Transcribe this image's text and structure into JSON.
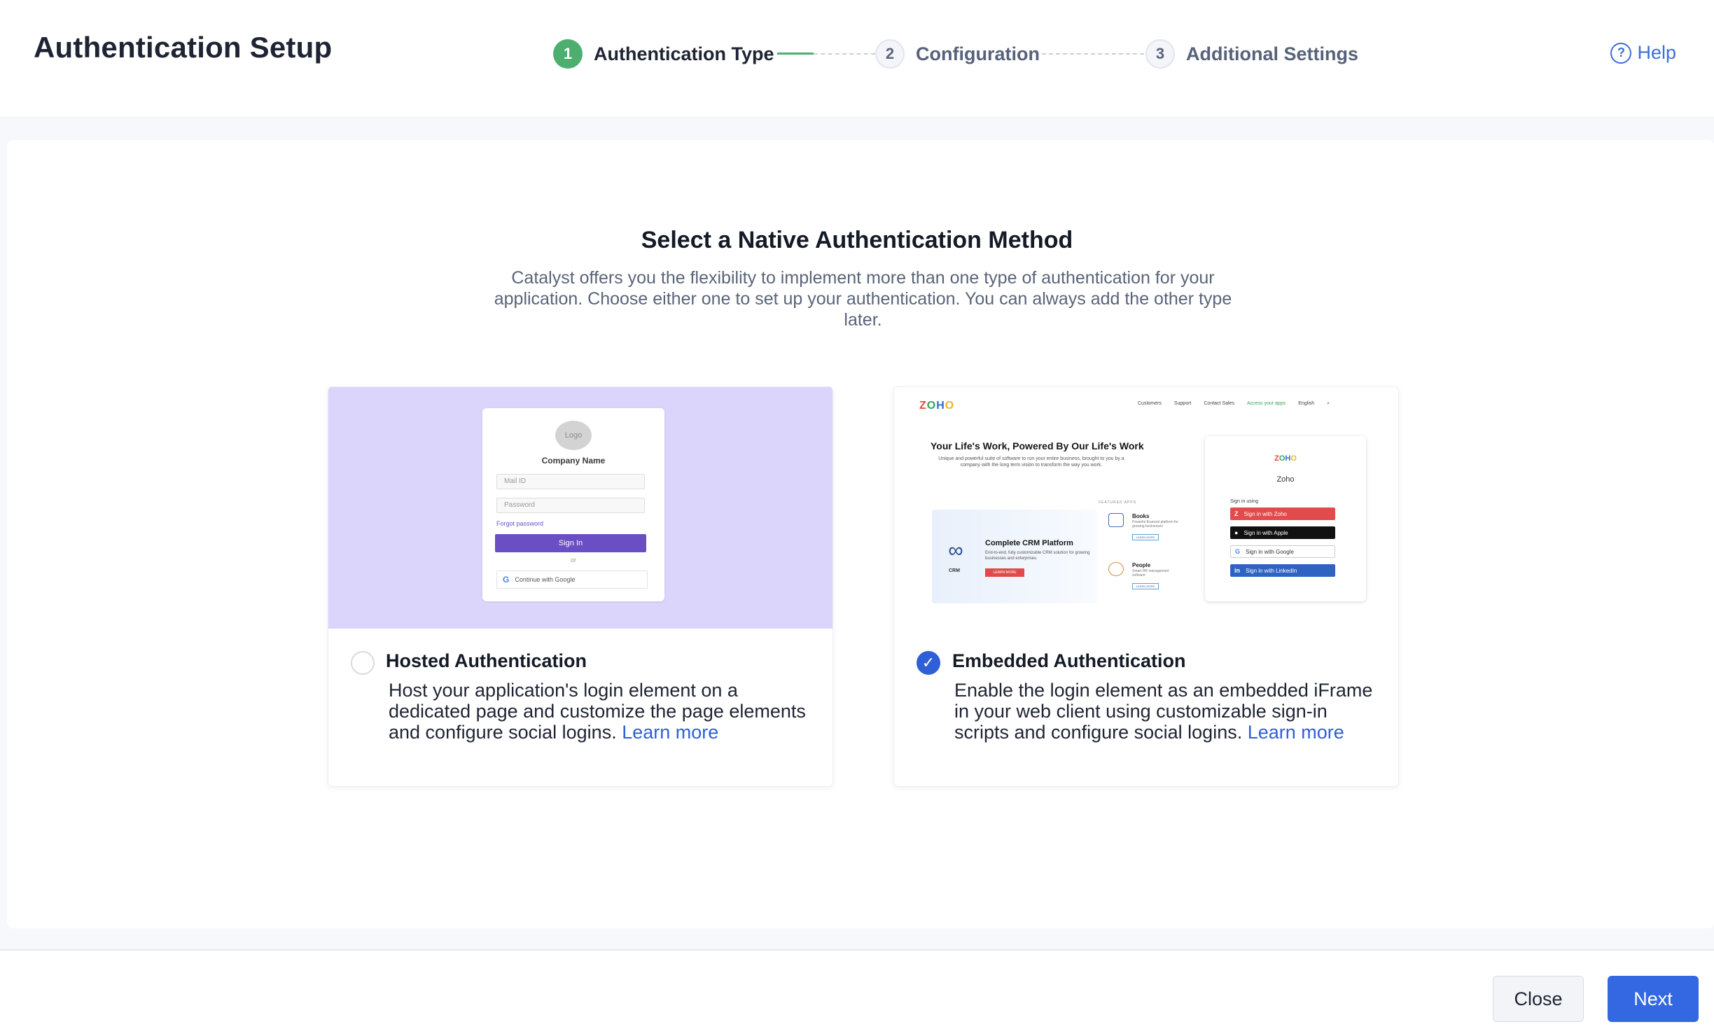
{
  "header": {
    "title": "Authentication Setup",
    "help_label": "Help",
    "help_icon": "question-circle-icon"
  },
  "stepper": {
    "steps": [
      {
        "number": "1",
        "label": "Authentication Type",
        "state": "active"
      },
      {
        "number": "2",
        "label": "Configuration",
        "state": "pending"
      },
      {
        "number": "3",
        "label": "Additional Settings",
        "state": "pending"
      }
    ],
    "active_color": "#4caf70"
  },
  "main": {
    "title": "Select a Native Authentication Method",
    "description": "Catalyst offers you the flexibility to implement more than one type of authentication for your application. Choose either one to set up your authentication. You can always add the other type later."
  },
  "options": {
    "hosted": {
      "title": "Hosted Authentication",
      "description": "Host your application's login element on a dedicated page and customize the page elements and configure social logins.",
      "learn_more": "Learn more",
      "selected": false,
      "preview": {
        "logo_text": "Logo",
        "company_name": "Company Name",
        "mail_placeholder": "Mail ID",
        "password_placeholder": "Password",
        "forgot_password": "Forgot password",
        "sign_in": "Sign In",
        "or": "or",
        "google": "Continue with Google"
      }
    },
    "embedded": {
      "title": "Embedded Authentication",
      "description": "Enable the login element as an embedded iFrame in your web client using customizable sign-in scripts and configure social logins.",
      "learn_more": "Learn more",
      "selected": true,
      "preview": {
        "brand": "ZOHO",
        "nav": [
          "Customers",
          "Support",
          "Contact Sales",
          "Access your apps",
          "English"
        ],
        "hero_title": "Your Life's Work, Powered By Our Life's Work",
        "hero_sub": "Unique and powerful suite of software to run your entire business, brought to you by a company with the long term vision to transform the way you work.",
        "featured": "FEATURED APPS",
        "crm_small": "CRM",
        "crm_title": "Complete CRM Platform",
        "crm_sub": "End-to-end, fully customizable CRM solution for growing businesses and enterprises.",
        "crm_btn": "LEARN MORE",
        "apps": [
          {
            "title": "Books",
            "sub": "Powerful financial platform for growing businesses",
            "btn": "LEARN MORE"
          },
          {
            "title": "People",
            "sub": "Smart HR management software",
            "btn": "LEARN MORE"
          }
        ],
        "signin_name": "Zoho",
        "signin_using": "Sign in using",
        "signin_buttons": [
          "Sign in with Zoho",
          "Sign in with Apple",
          "Sign in with Google",
          "Sign in with LinkedIn"
        ]
      }
    }
  },
  "footer": {
    "close_label": "Close",
    "next_label": "Next"
  },
  "colors": {
    "accent": "#3467e2",
    "hosted_preview_bg": "#dcd5fb"
  }
}
